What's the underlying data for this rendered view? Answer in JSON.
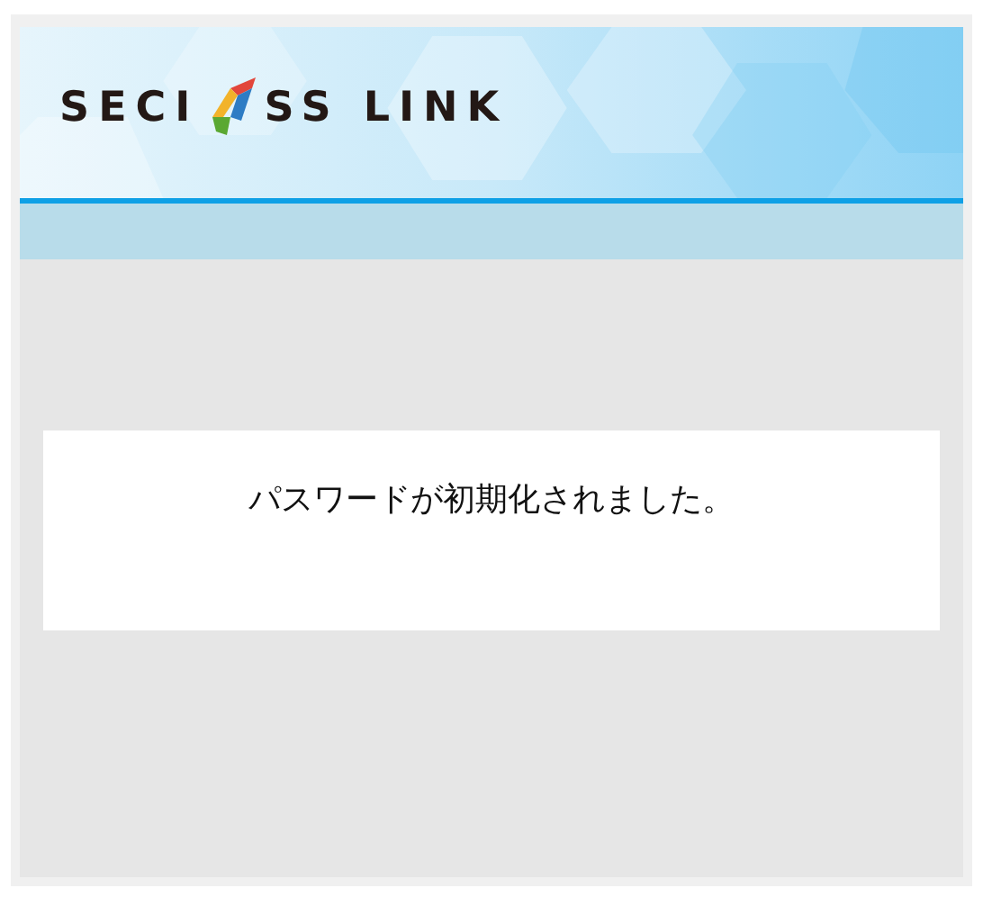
{
  "header": {
    "logo": {
      "text_before_mark": "SECI",
      "text_after_mark": "SS LINK"
    }
  },
  "message": {
    "text": "パスワードが初期化されました。"
  }
}
